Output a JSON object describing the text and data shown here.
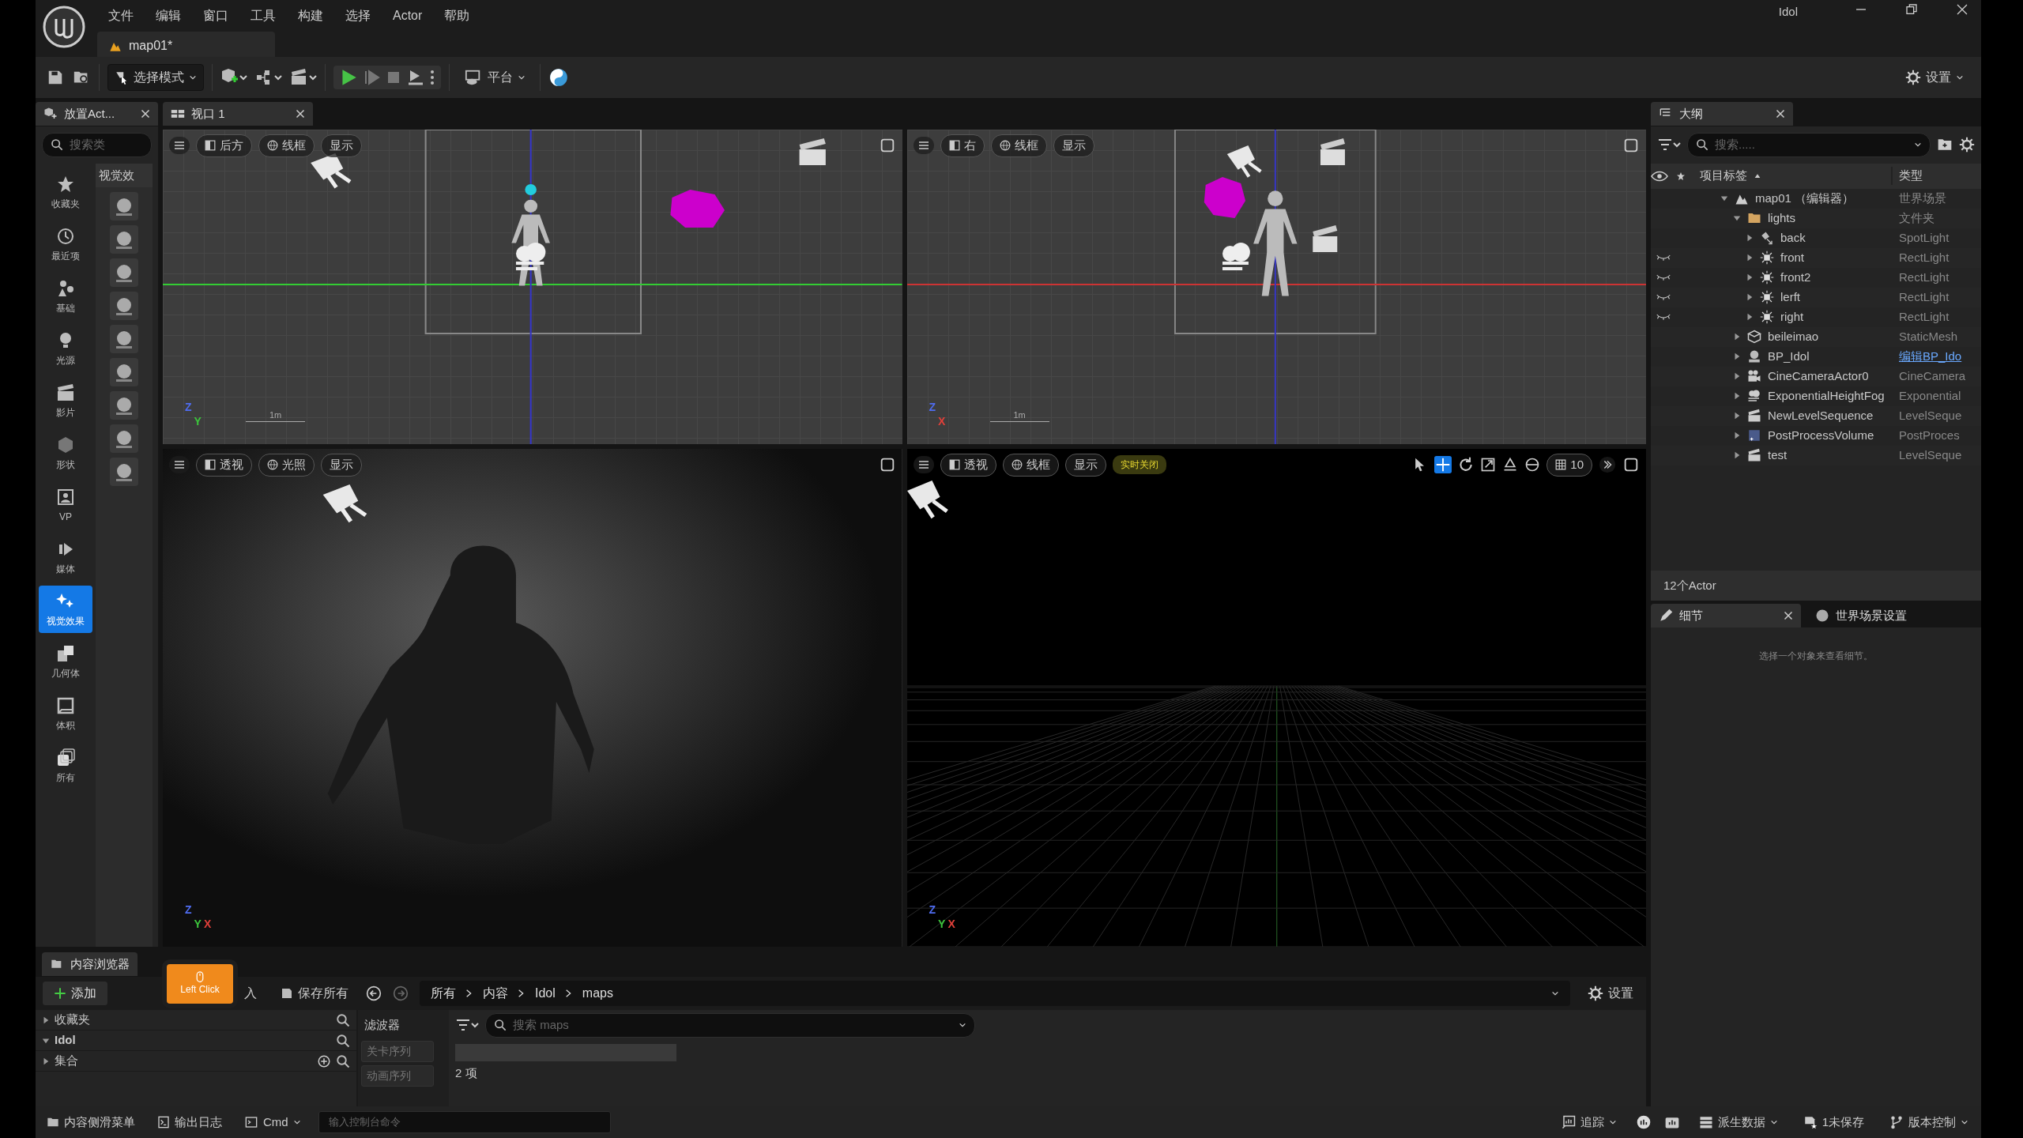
{
  "window": {
    "title": "Idol",
    "menu": [
      "文件",
      "编辑",
      "窗口",
      "工具",
      "构建",
      "选择",
      "Actor",
      "帮助"
    ],
    "document_tab": "map01*"
  },
  "toolbar": {
    "mode_button": "选择模式",
    "platform_button": "平台",
    "settings_button": "设置"
  },
  "place_actors": {
    "tab": "放置Act...",
    "search_placeholder": "搜索类",
    "section_title": "视觉效",
    "categories": [
      {
        "label": "收藏夹",
        "selected": false
      },
      {
        "label": "最近项",
        "selected": false
      },
      {
        "label": "基础",
        "selected": false
      },
      {
        "label": "光源",
        "selected": false
      },
      {
        "label": "影片",
        "selected": false
      },
      {
        "label": "形状",
        "selected": false
      },
      {
        "label": "VP",
        "selected": false
      },
      {
        "label": "媒体",
        "selected": false
      },
      {
        "label": "视觉效果",
        "selected": true
      },
      {
        "label": "几何体",
        "selected": false
      },
      {
        "label": "体积",
        "selected": false
      },
      {
        "label": "所有",
        "selected": false
      }
    ]
  },
  "viewport_tab": "视口 1",
  "viewports": [
    {
      "kind": "ortho_front",
      "buttons": [
        "后方",
        "线框",
        "显示"
      ],
      "scale": "1m",
      "axes": [
        {
          "label": "Z",
          "color": "#4f6cf0"
        },
        {
          "label": "Y",
          "color": "#3cc43c"
        }
      ]
    },
    {
      "kind": "ortho_right",
      "buttons": [
        "右",
        "线框",
        "显示"
      ],
      "scale": "1m",
      "axes": [
        {
          "label": "Z",
          "color": "#4f6cf0"
        },
        {
          "label": "X",
          "color": "#e0403a"
        }
      ]
    },
    {
      "kind": "lit",
      "buttons": [
        "透视",
        "光照",
        "显示"
      ],
      "axes": [
        {
          "label": "Z",
          "color": "#4f6cf0"
        },
        {
          "label": "Y",
          "color": "#3cc43c"
        },
        {
          "label": "X",
          "color": "#e0403a"
        }
      ]
    },
    {
      "kind": "wireframe",
      "buttons": [
        "透视",
        "线框",
        "显示"
      ],
      "realtime_badge": "实时关闭",
      "grid_snap": "10",
      "axes": [
        {
          "label": "Z",
          "color": "#4f6cf0"
        },
        {
          "label": "Y",
          "color": "#3cc43c"
        },
        {
          "label": "X",
          "color": "#e0403a"
        }
      ]
    }
  ],
  "outliner": {
    "tab": "大纲",
    "search_placeholder": "搜索.....",
    "columns": [
      "项目标签",
      "类型"
    ],
    "count": "12个Actor",
    "tree": [
      {
        "label": "map01 （编辑器）",
        "type": "世界场景",
        "kind": "level",
        "visible": true,
        "expanded": true,
        "type_link": false,
        "children": [
          {
            "label": "lights",
            "type": "文件夹",
            "kind": "folder",
            "visible": true,
            "expanded": true,
            "type_link": false,
            "children": [
              {
                "label": "back",
                "type": "SpotLight",
                "kind": "spotlight",
                "visible": true,
                "expanded": false,
                "type_link": false
              },
              {
                "label": "front",
                "type": "RectLight",
                "kind": "rectlight",
                "visible": false,
                "expanded": false,
                "type_link": false
              },
              {
                "label": "front2",
                "type": "RectLight",
                "kind": "rectlight",
                "visible": false,
                "expanded": false,
                "type_link": false
              },
              {
                "label": "lerft",
                "type": "RectLight",
                "kind": "rectlight",
                "visible": false,
                "expanded": false,
                "type_link": false
              },
              {
                "label": "right",
                "type": "RectLight",
                "kind": "rectlight",
                "visible": false,
                "expanded": false,
                "type_link": false
              }
            ]
          },
          {
            "label": "beileimao",
            "type": "StaticMesh",
            "kind": "mesh",
            "visible": true,
            "expanded": false,
            "type_link": false
          },
          {
            "label": "BP_Idol",
            "type": "编辑BP_Ido",
            "kind": "blueprint",
            "visible": true,
            "expanded": false,
            "type_link": true
          },
          {
            "label": "CineCameraActor0",
            "type": "CineCamera",
            "kind": "camera",
            "visible": true,
            "expanded": false,
            "type_link": false
          },
          {
            "label": "ExponentialHeightFog",
            "type": "Exponential",
            "kind": "fog",
            "visible": true,
            "expanded": false,
            "type_link": false
          },
          {
            "label": "NewLevelSequence",
            "type": "LevelSeque",
            "kind": "sequence",
            "visible": true,
            "expanded": false,
            "type_link": false
          },
          {
            "label": "PostProcessVolume",
            "type": "PostProces",
            "kind": "volume",
            "visible": true,
            "expanded": false,
            "type_link": false
          },
          {
            "label": "test",
            "type": "LevelSeque",
            "kind": "sequence",
            "visible": true,
            "expanded": false,
            "type_link": false
          }
        ]
      }
    ]
  },
  "details": {
    "tabs": [
      {
        "label": "细节",
        "selected": true
      },
      {
        "label": "世界场景设置",
        "selected": false
      }
    ],
    "empty_text": "选择一个对象来查看细节。"
  },
  "content_browser": {
    "title": "内容浏览器",
    "add_button": "添加",
    "import_button": "入",
    "save_all_button": "保存所有",
    "breadcrumb": [
      "所有",
      "内容",
      "Idol",
      "maps"
    ],
    "settings_button": "设置",
    "tree": [
      {
        "label": "收藏夹",
        "expanded": false
      },
      {
        "label": "Idol",
        "expanded": true
      },
      {
        "label": "集合",
        "expanded": false
      }
    ],
    "filters_title": "滤波器",
    "filters": [
      "关卡序列",
      "动画序列"
    ],
    "search_placeholder": "搜索 maps",
    "count": "2 项",
    "click_overlay": "Left Click"
  },
  "status_bar": {
    "left": [
      "内容侧滑菜单",
      "输出日志"
    ],
    "cmd_button": "Cmd",
    "console_placeholder": "输入控制台命令",
    "right": [
      "追踪",
      "派生数据",
      "1未保存",
      "版本控制"
    ]
  }
}
